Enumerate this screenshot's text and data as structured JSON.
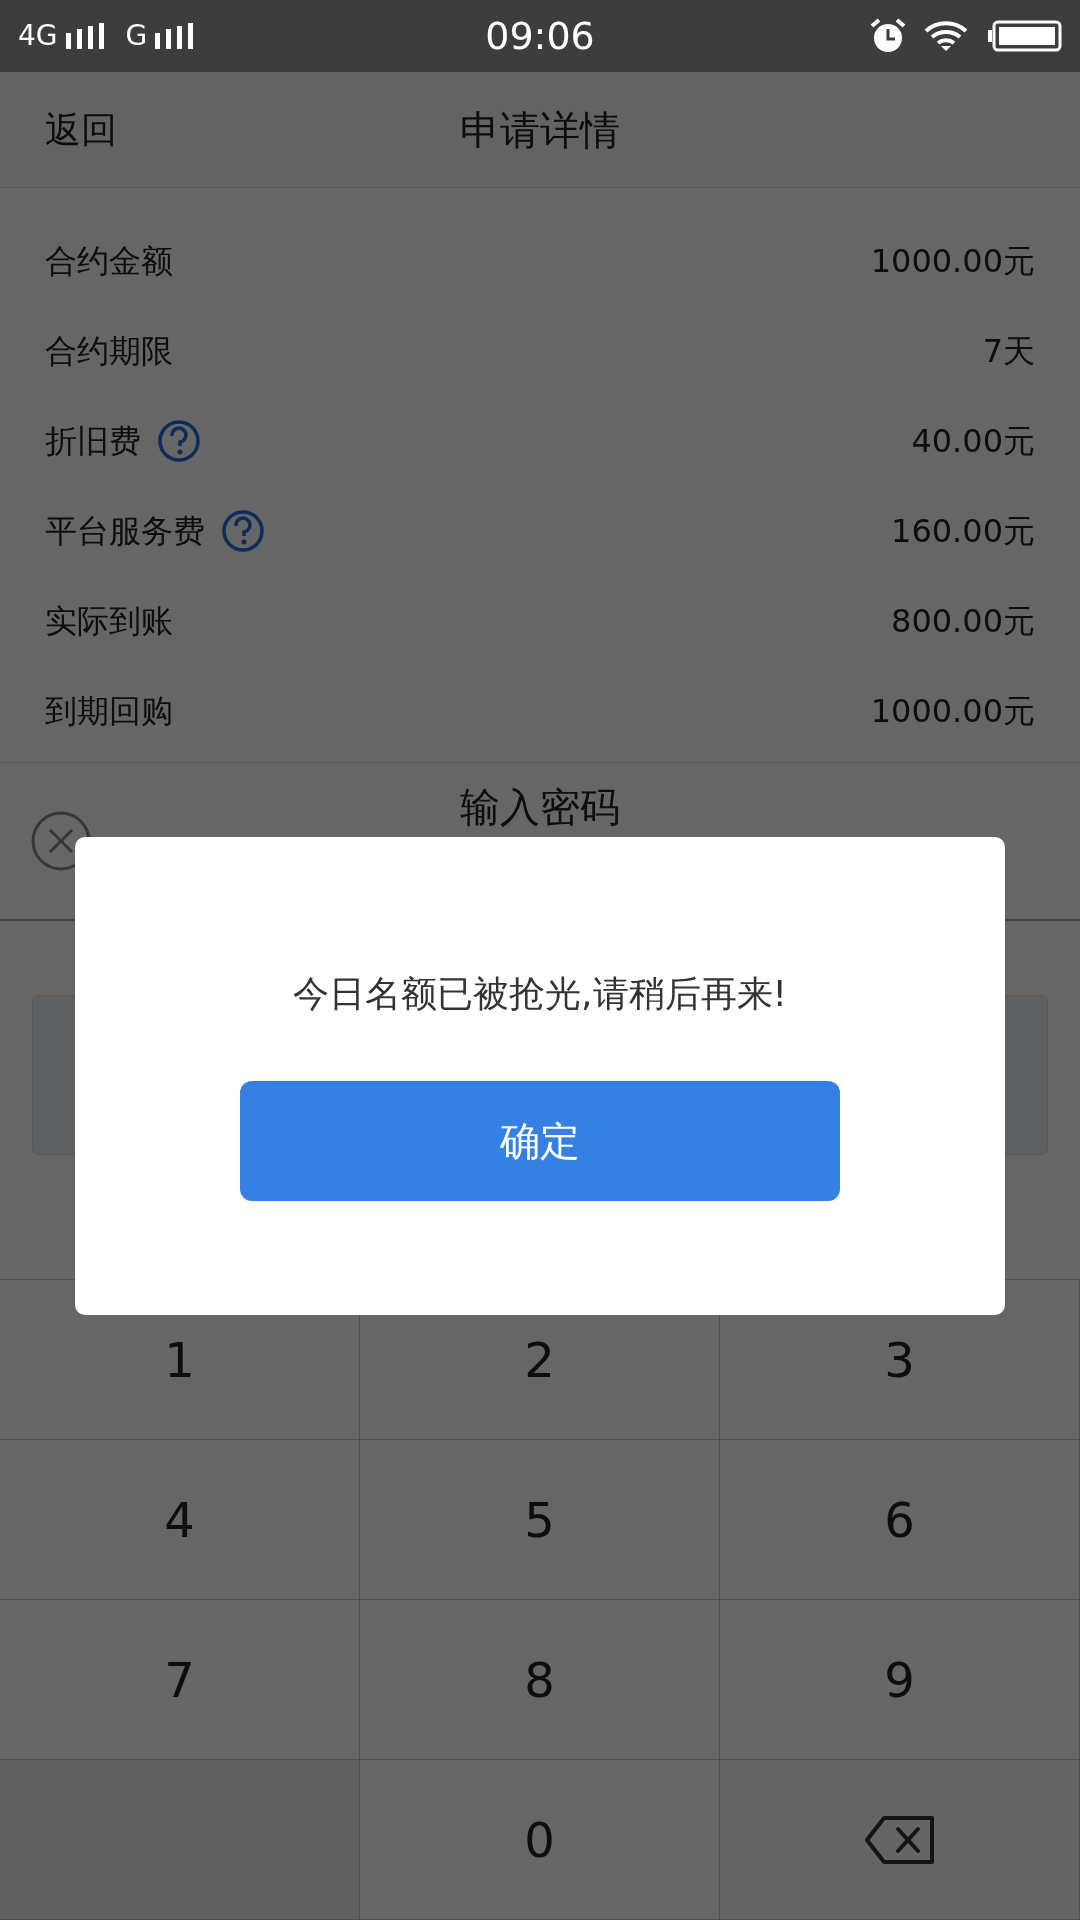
{
  "status_bar": {
    "carrier_1": "4G",
    "carrier_2": "G",
    "time": "09:06"
  },
  "nav": {
    "back": "返回",
    "title": "申请详情"
  },
  "details": [
    {
      "label": "合约金额",
      "value": "1000.00元",
      "help": false
    },
    {
      "label": "合约期限",
      "value": "7天",
      "help": false
    },
    {
      "label": "折旧费",
      "value": "40.00元",
      "help": true
    },
    {
      "label": "平台服务费",
      "value": "160.00元",
      "help": true
    },
    {
      "label": "实际到账",
      "value": "800.00元",
      "help": false
    },
    {
      "label": "到期回购",
      "value": "1000.00元",
      "help": false
    }
  ],
  "sheet": {
    "title": "输入密码"
  },
  "keypad": [
    {
      "kind": "digit",
      "label": "1"
    },
    {
      "kind": "digit",
      "label": "2"
    },
    {
      "kind": "digit",
      "label": "3"
    },
    {
      "kind": "digit",
      "label": "4"
    },
    {
      "kind": "digit",
      "label": "5"
    },
    {
      "kind": "digit",
      "label": "6"
    },
    {
      "kind": "digit",
      "label": "7"
    },
    {
      "kind": "digit",
      "label": "8"
    },
    {
      "kind": "digit",
      "label": "9"
    },
    {
      "kind": "blank"
    },
    {
      "kind": "digit",
      "label": "0"
    },
    {
      "kind": "backspace"
    }
  ],
  "dialog": {
    "message": "今日名额已被抢光,请稍后再来!",
    "button": "确定"
  }
}
